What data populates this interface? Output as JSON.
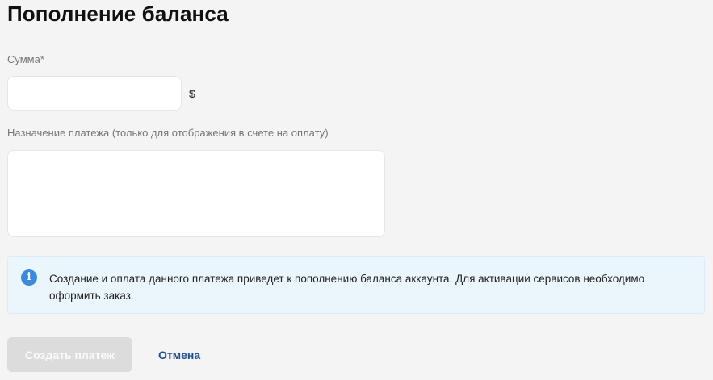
{
  "page": {
    "title": "Пополнение баланса"
  },
  "form": {
    "amount": {
      "label": "Сумма*",
      "value": "",
      "placeholder": "",
      "currency": "$"
    },
    "purpose": {
      "label": "Назначение платежа (только для отображения в счете на оплату)",
      "value": "",
      "placeholder": ""
    }
  },
  "info": {
    "icon": "info-icon",
    "icon_glyph": "i",
    "text": "Создание и оплата данного платежа приведет к пополнению баланса аккаунта. Для активации сервисов необходимо оформить заказ."
  },
  "actions": {
    "create_label": "Создать платеж",
    "cancel_label": "Отмена"
  },
  "colors": {
    "background": "#f4f4f4",
    "info_background": "#ebf5fc",
    "info_icon": "#3a8be0",
    "link": "#1f4e8c",
    "button_disabled": "#dcdcdc"
  }
}
